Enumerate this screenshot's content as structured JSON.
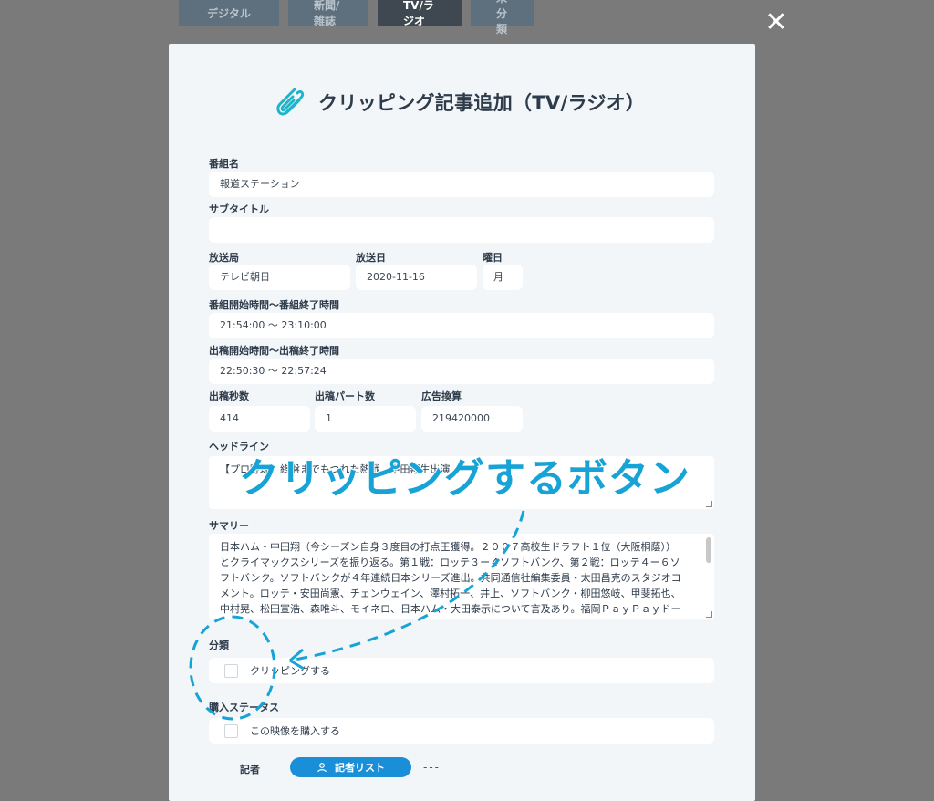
{
  "tabs": [
    "デジタル",
    "新聞/雑誌",
    "TV/ラジオ",
    "未分類"
  ],
  "modal": {
    "title": "クリッピング記事追加（TV/ラジオ）",
    "program_name_label": "番組名",
    "program_name_value": "報道ステーション",
    "subtitle_label": "サブタイトル",
    "subtitle_value": "",
    "station_label": "放送局",
    "station_value": "テレビ朝日",
    "air_date_label": "放送日",
    "air_date_value": "2020-11-16",
    "weekday_label": "曜日",
    "weekday_value": "月",
    "program_time_label": "番組開始時間〜番組終了時間",
    "program_time_value": "21:54:00 〜 23:10:00",
    "appearance_time_label": "出稿開始時間〜出稿終了時間",
    "appearance_time_value": "22:50:30 〜 22:57:24",
    "seconds_label": "出稿秒数",
    "seconds_value": "414",
    "parts_label": "出稿パート数",
    "parts_value": "1",
    "ad_value_label": "広告換算",
    "ad_value_value": "219420000",
    "headline_label": "ヘッドライン",
    "headline_value": "【プロ野球】終盤までもつれた熱戦　中田翔生出演",
    "summary_label": "サマリー",
    "summary_lines": [
      "日本ハム・中田翔（今シーズン自身３度目の打点王獲得。２００７高校生ドラフト１位（大阪桐蔭））",
      "とクライマックスシリーズを振り返る。第１戦：ロッテ３ー４ソフトバンク、第２戦：ロッテ４ー６ソ",
      "フトバンク。ソフトバンクが４年連続日本シリーズ進出。共同通信社編集委員・太田昌克のスタジオコ",
      "メント。ロッテ・安田尚憲、チェンウェイン、澤村拓一、井上、ソフトバンク・柳田悠岐、甲斐拓也、",
      "中村晃、松田宣浩、森唯斗、モイネロ、日本ハム・大田泰示について言及あり。福岡ＰａｙＰａｙドー"
    ],
    "category_label": "分類",
    "clipping_checkbox_label": "クリッピングする",
    "purchase_status_label": "購入ステータス",
    "purchase_checkbox_label": "この映像を購入する",
    "reporter_label": "記者",
    "reporter_list_button": "記者リスト",
    "reporter_value": "---"
  },
  "annotation": {
    "callout_text": "クリッピングするボタン",
    "color": "#17a3d6"
  },
  "colors": {
    "overlay": "#7a7a7a",
    "modal_bg": "#f2f6f9",
    "accent": "#1a8fd8",
    "title_icon": "#1fb4c8"
  }
}
